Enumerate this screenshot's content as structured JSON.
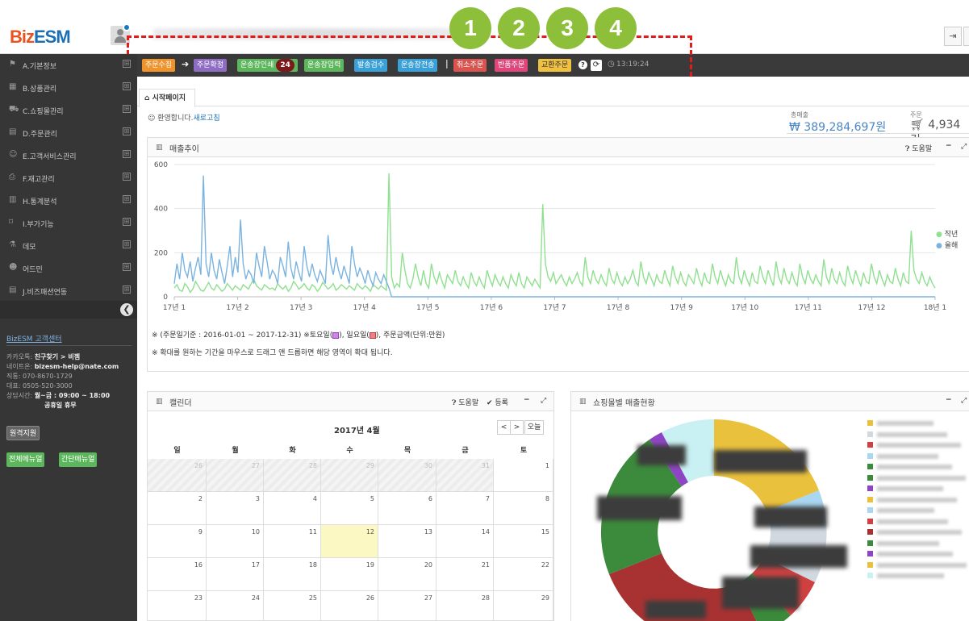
{
  "app": {
    "logo_biz": "Biz",
    "logo_esm": "ESM"
  },
  "toolbar": {
    "steps": [
      {
        "label": "주문수집",
        "color": "#f0932b"
      },
      {
        "label": "주문확정",
        "color": "#8e6cc4"
      },
      {
        "label": "운송장인쇄",
        "count": "24",
        "color": "#5cb65c"
      },
      {
        "label": "운송장입력",
        "color": "#5cb65c"
      },
      {
        "label": "발송검수",
        "color": "#3aa0d8"
      },
      {
        "label": "운송장전송",
        "color": "#3aa0d8"
      }
    ],
    "actions": [
      {
        "label": "취소주문",
        "color": "#d9534f"
      },
      {
        "label": "반품주문",
        "color": "#e0457b"
      },
      {
        "label": "교환주문",
        "color": "#f0c040",
        "text_color": "#333333"
      }
    ],
    "time": "13:19:24",
    "arrow_icon": "arrow-right-icon",
    "separator": "|"
  },
  "annotation": {
    "numbers": [
      "1",
      "2",
      "3",
      "4"
    ],
    "color": "#e31b1b",
    "circle_color": "#8dbf3a"
  },
  "sidebar": {
    "items": [
      {
        "icon": "flag-icon",
        "glyph": "⚑",
        "label": "A.기본정보"
      },
      {
        "icon": "barcode-icon",
        "glyph": "▦",
        "label": "B.상품관리"
      },
      {
        "icon": "cart-icon",
        "glyph": "⛟",
        "label": "C.쇼핑몰관리"
      },
      {
        "icon": "list-icon",
        "glyph": "▤",
        "label": "D.주문관리"
      },
      {
        "icon": "smile-icon",
        "glyph": "☺",
        "label": "E.고객서비스관리"
      },
      {
        "icon": "printer-icon",
        "glyph": "⎙",
        "label": "F.재고관리"
      },
      {
        "icon": "chart-icon",
        "glyph": "▥",
        "label": "H.통계분석"
      },
      {
        "icon": "bookmark-icon",
        "glyph": "⌑",
        "label": "I.부가기능"
      },
      {
        "icon": "flask-icon",
        "glyph": "⚗",
        "label": "데모"
      },
      {
        "icon": "users-icon",
        "glyph": "☻",
        "label": "어드민"
      },
      {
        "icon": "table-icon",
        "glyph": "▤",
        "label": "J.비즈패션연동"
      }
    ],
    "plus": "⊞",
    "cs": {
      "title": "BizESM 고객센터",
      "kakao_label": "카카오톡: ",
      "kakao_value": "친구찾기 > 비젬",
      "nateon_label": "네이트온: ",
      "nateon_value": "bizesm-help@nate.com",
      "direct": "직통: 070-8670-1729",
      "main": "대표: 0505-520-3000",
      "hours_label": "상담시간: ",
      "hours_value": "월~금 : 09:00 ~ 18:00",
      "holiday": "공휴일 휴무"
    },
    "buttons": {
      "remote": "원격지원",
      "full_manual": "전체메뉴얼",
      "quick_manual": "간단메뉴얼"
    }
  },
  "page": {
    "tab": "시작페이지",
    "welcome": "환영합니다.",
    "refresh": "새로고침",
    "sales_label": "총매출",
    "sales_value": "₩ 389,284,697원",
    "orders_label": "주문",
    "orders_value": "4,934건"
  },
  "sales_panel": {
    "title": "매출추이",
    "help": "도움말",
    "note1": "※ (주문일기준 : 2016-01-01 ~ 2017-12-31) ※토요일(",
    "note1_mid": "), 일요일(",
    "note1_end": "), 주문금액(단위:만원)",
    "note2": "※ 확대를 원하는 기간을 마우스로 드래그 앤 드롭하면 해당 영역이 확대 됩니다."
  },
  "chart_data": {
    "type": "line",
    "x": [
      "17년 1",
      "17년 2",
      "17년 3",
      "17년 4",
      "17년 5",
      "17년 6",
      "17년 7",
      "17년 8",
      "17년 9",
      "17년 10",
      "17년 11",
      "17년 12",
      "18년 1"
    ],
    "ylim": [
      0,
      600
    ],
    "yticks": [
      0,
      200,
      400,
      600
    ],
    "grid": true,
    "legend": "right",
    "series": [
      {
        "name": "작년",
        "color": "#8fe08f",
        "values": [
          40,
          55,
          30,
          25,
          60,
          45,
          20,
          35,
          70,
          50,
          30,
          25,
          45,
          65,
          40,
          30,
          55,
          40,
          25,
          35,
          60,
          45,
          30,
          50,
          40,
          30,
          55,
          45,
          35,
          60,
          80,
          50,
          40,
          30,
          55,
          45,
          35,
          40,
          30,
          60,
          45,
          35,
          50,
          25,
          40,
          70,
          55,
          35,
          45,
          60,
          40,
          30,
          55,
          45,
          25,
          40,
          65,
          50,
          35,
          45,
          60,
          30,
          40,
          55,
          45,
          35,
          50,
          40,
          30,
          60,
          45,
          35,
          50,
          40,
          25,
          55,
          45,
          35,
          50,
          40,
          30,
          560,
          90,
          40,
          60,
          45,
          200,
          120,
          60,
          40,
          80,
          150,
          90,
          50,
          120,
          60,
          40,
          150,
          90,
          60,
          110,
          70,
          40,
          100,
          80,
          60,
          120,
          70,
          50,
          90,
          60,
          40,
          110,
          70,
          50,
          90,
          60,
          40,
          120,
          80,
          50,
          100,
          70,
          50,
          90,
          60,
          40,
          100,
          70,
          50,
          110,
          60,
          40,
          90,
          70,
          50,
          80,
          60,
          40,
          420,
          150,
          90,
          70,
          110,
          60,
          80,
          100,
          70,
          50,
          90,
          60,
          80,
          110,
          70,
          50,
          180,
          90,
          60,
          120,
          80,
          60,
          100,
          70,
          50,
          130,
          80,
          60,
          110,
          70,
          50,
          90,
          60,
          80,
          120,
          70,
          50,
          160,
          90,
          60,
          110,
          80,
          50,
          100,
          70,
          60,
          120,
          80,
          50,
          140,
          90,
          60,
          110,
          70,
          50,
          100,
          80,
          60,
          130,
          80,
          50,
          110,
          70,
          60,
          150,
          90,
          60,
          120,
          80,
          50,
          100,
          70,
          60,
          180,
          90,
          60,
          120,
          80,
          50,
          110,
          70,
          60,
          140,
          90,
          60,
          120,
          80,
          50,
          160,
          90,
          60,
          130,
          80,
          60,
          110,
          70,
          50,
          150,
          90,
          60,
          120,
          80,
          60,
          100,
          70,
          50,
          170,
          90,
          60,
          130,
          80,
          60,
          110,
          70,
          50,
          140,
          90,
          60,
          120,
          80,
          50,
          110,
          70,
          60,
          150,
          90,
          60,
          120,
          80,
          50,
          100,
          70,
          60,
          130,
          80,
          50,
          110,
          70,
          60,
          300,
          120,
          80,
          60,
          110,
          70,
          50,
          90,
          60,
          40
        ]
      },
      {
        "name": "올해",
        "color": "#7bb3e0",
        "values": [
          60,
          150,
          80,
          200,
          120,
          90,
          160,
          70,
          130,
          180,
          100,
          550,
          150,
          90,
          200,
          120,
          80,
          170,
          110,
          60,
          140,
          230,
          90,
          180,
          110,
          350,
          150,
          80,
          120,
          100,
          60,
          200,
          140,
          90,
          230,
          160,
          80,
          120,
          100,
          60,
          180,
          140,
          90,
          250,
          130,
          80,
          160,
          110,
          70,
          230,
          140,
          90,
          150,
          100,
          70,
          120,
          90,
          60,
          280,
          150,
          100,
          180,
          120,
          80,
          140,
          100,
          60,
          230,
          150,
          90,
          130,
          100,
          60,
          120,
          80,
          50,
          110,
          80,
          60,
          100,
          70,
          40,
          0
        ]
      }
    ]
  },
  "calendar_panel": {
    "title": "캘린더",
    "help": "도움말",
    "register": "등록",
    "month": "2017년 4월",
    "today_btn": "오늘",
    "prev": "<",
    "next": ">",
    "dow": [
      "일",
      "월",
      "화",
      "수",
      "목",
      "금",
      "토"
    ],
    "weeks": [
      [
        "26",
        "27",
        "28",
        "29",
        "30",
        "31",
        "1"
      ],
      [
        "2",
        "3",
        "4",
        "5",
        "6",
        "7",
        "8"
      ],
      [
        "9",
        "10",
        "11",
        "12",
        "13",
        "14",
        "15"
      ],
      [
        "16",
        "17",
        "18",
        "19",
        "20",
        "21",
        "22"
      ],
      [
        "23",
        "24",
        "25",
        "26",
        "27",
        "28",
        "29"
      ]
    ]
  },
  "mall_panel": {
    "title": "쇼핑몰별 매출현황"
  }
}
